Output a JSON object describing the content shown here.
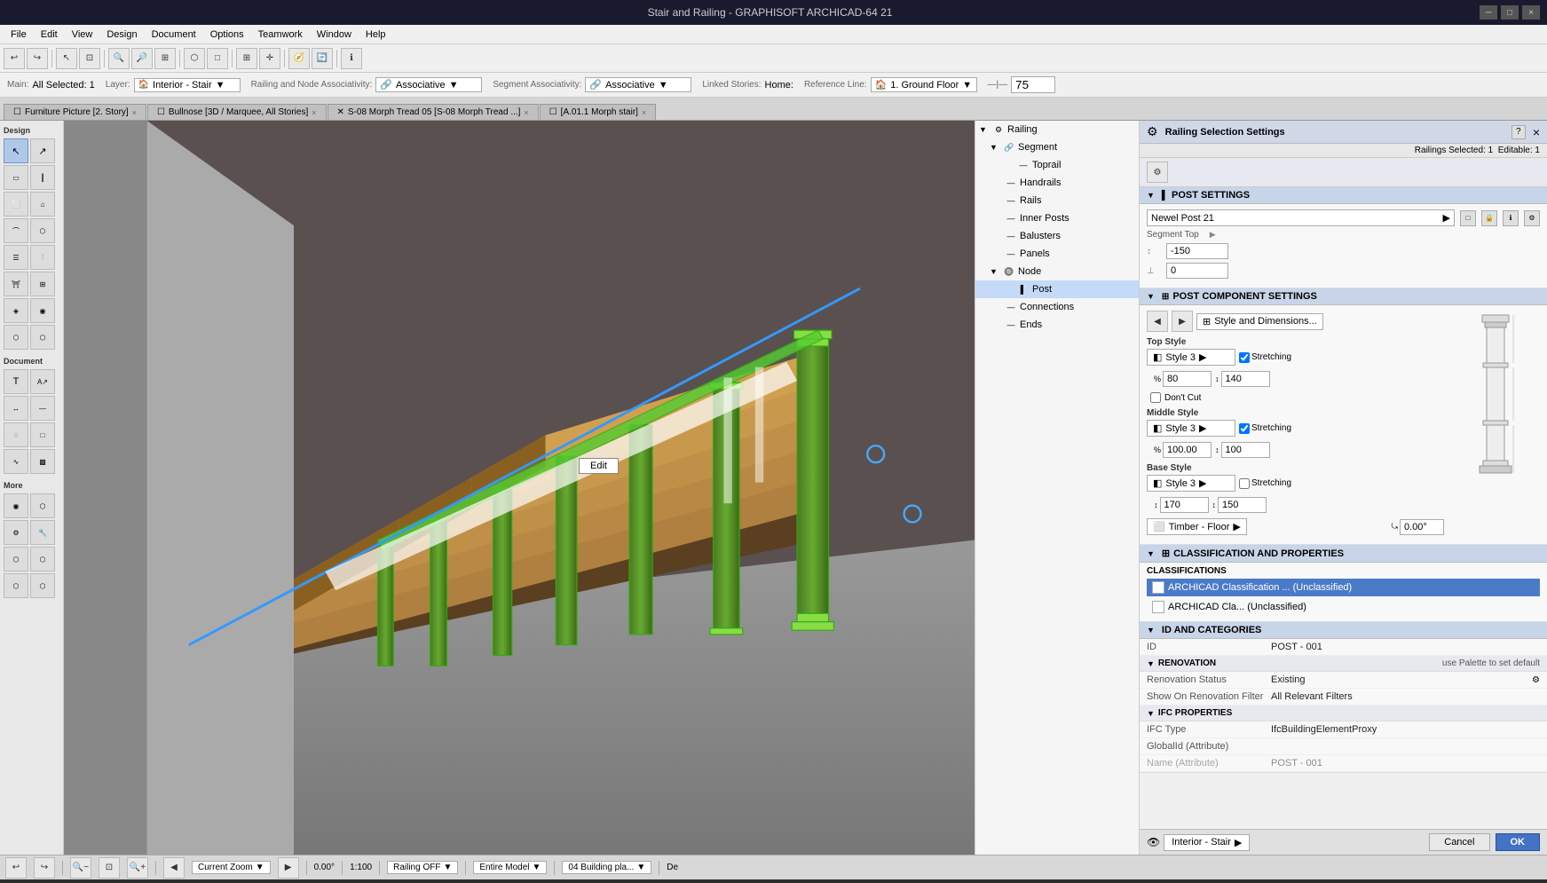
{
  "titlebar": {
    "title": "Stair and Railing - GRAPHISOFT ARCHICAD-64 21",
    "controls": [
      "minimize",
      "maximize",
      "close"
    ]
  },
  "menubar": {
    "items": [
      "File",
      "Edit",
      "View",
      "Design",
      "Document",
      "Options",
      "Teamwork",
      "Window",
      "Help"
    ]
  },
  "propbar": {
    "main_label": "Main:",
    "selected_label": "All Selected: 1",
    "layer_label": "Layer:",
    "layer_value": "",
    "assoc_label": "Railing and Node Associativity:",
    "assoc_value": "Associative",
    "seg_assoc_label": "Segment Associativity:",
    "seg_assoc_value": "Associative",
    "linked_label": "Linked Stories:",
    "linked_value": "Home:",
    "ref_label": "Reference Line:",
    "ref_value": "1. Ground Floor",
    "zoom_value": "75"
  },
  "tabs": [
    {
      "label": "Furniture Picture [2. Story]",
      "active": false
    },
    {
      "label": "Bullnose [3D / Marquee, All Stories]",
      "active": false
    },
    {
      "label": "S-08 Morph Tread 05 [S-08 Morph Tread ...]",
      "active": false
    },
    {
      "label": "[A.01.1 Morph stair]",
      "active": false
    }
  ],
  "left_toolbar": {
    "sections": [
      {
        "label": "Design",
        "buttons": [
          "↖",
          "◻",
          "⬜",
          "⬜",
          "⬜",
          "⬜",
          "⬜",
          "⬜",
          "⬜",
          "⬜",
          "⬜",
          "⬜",
          "⬜",
          "⬜",
          "⬜",
          "⬜",
          "⬜",
          "⬜"
        ]
      },
      {
        "label": "Document",
        "buttons": [
          "T",
          "A",
          "✏",
          "—",
          "○",
          "□",
          "⬡",
          "⬡"
        ]
      },
      {
        "label": "More",
        "buttons": [
          "⬡",
          "⬡",
          "⬡",
          "⬡",
          "⬡",
          "⬡",
          "⬡",
          "⬡"
        ]
      }
    ]
  },
  "tree": {
    "items": [
      {
        "label": "Railing",
        "level": 0,
        "expanded": true,
        "icon": "🔩"
      },
      {
        "label": "Segment",
        "level": 1,
        "expanded": true,
        "icon": "🔗"
      },
      {
        "label": "Toprail",
        "level": 2,
        "icon": "—"
      },
      {
        "label": "Handrails",
        "level": 2,
        "icon": "—"
      },
      {
        "label": "Rails",
        "level": 2,
        "icon": "—"
      },
      {
        "label": "Inner Posts",
        "level": 2,
        "icon": "—"
      },
      {
        "label": "Balusters",
        "level": 2,
        "icon": "—"
      },
      {
        "label": "Panels",
        "level": 2,
        "icon": "—"
      },
      {
        "label": "Node",
        "level": 1,
        "expanded": true,
        "icon": "🔘"
      },
      {
        "label": "Post",
        "level": 2,
        "selected": true,
        "icon": "▌"
      },
      {
        "label": "Connections",
        "level": 2,
        "icon": "—"
      },
      {
        "label": "Ends",
        "level": 2,
        "icon": "—"
      }
    ]
  },
  "railing_settings": {
    "dialog_title": "Railing Selection Settings",
    "selected_label": "Railings Selected: 1",
    "editable_label": "Editable: 1",
    "close_btn": "×",
    "help_btn": "?"
  },
  "post_settings": {
    "section_title": "POST SETTINGS",
    "newel_post_label": "Newel Post 21",
    "segment_top_label": "Segment Top",
    "value1": "-150",
    "value2": "0",
    "icons": [
      "lock",
      "info",
      "settings"
    ]
  },
  "post_component": {
    "section_title": "POST COMPONENT SETTINGS",
    "nav_prev": "◀",
    "nav_next": "▶",
    "style_label": "Style and Dimensions...",
    "top_style_label": "Top Style",
    "top_style_value": "Style 3",
    "top_stretching_label": "Stretching",
    "top_val1": "80",
    "top_val2": "140",
    "dont_cut_label": "Don't Cut",
    "middle_style_label": "Middle Style",
    "middle_style_value": "Style 3",
    "middle_stretching_label": "Stretching",
    "middle_val1": "100.00",
    "middle_val2": "100",
    "base_style_label": "Base Style",
    "base_style_value": "Style 3",
    "base_stretching_label": "Stretching",
    "base_val1": "170",
    "base_val2": "150",
    "material_label": "Timber - Floor",
    "rotation_label": "0.00°"
  },
  "classification": {
    "section_title": "CLASSIFICATION AND PROPERTIES",
    "classifications_label": "CLASSIFICATIONS",
    "row1": "ARCHICAD Classification ... (Unclassified)",
    "row2": "ARCHICAD Cla... (Unclassified)"
  },
  "id_categories": {
    "section_title": "ID AND CATEGORIES",
    "id_label": "ID",
    "id_value": "POST - 001",
    "renovation_label": "RENOVATION",
    "renovation_value": "use Palette to set default",
    "renov_status_label": "Renovation Status",
    "renov_status_value": "Existing",
    "show_on_label": "Show On Renovation Filter",
    "show_on_value": "All Relevant Filters",
    "ifc_label": "IFC PROPERTIES",
    "ifc_type_label": "IFC Type",
    "ifc_type_value": "IfcBuildingElementProxy",
    "globalid_label": "GlobalId (Attribute)",
    "globalid_value": "",
    "name_label": "Name (Attribute)",
    "name_value": "POST - 001"
  },
  "bottom_bar": {
    "prev_btn": "◀",
    "next_btn": "▶",
    "zoom_label": "Current Zoom",
    "angle_value": "0.00°",
    "scale_value": "1:100",
    "floor_label": "Railing OFF",
    "view_label": "Entire Model",
    "building_label": "04 Building pla...",
    "extra": "De",
    "interior_stair": "Interior - Stair",
    "cancel_btn": "Cancel",
    "ok_btn": "OK"
  },
  "edit_btn": "Edit",
  "icons": {
    "arrow": "▶",
    "collapse": "▼",
    "expand": "▶",
    "lock": "🔒",
    "eye": "👁",
    "link": "🔗",
    "globe": "🌐"
  }
}
